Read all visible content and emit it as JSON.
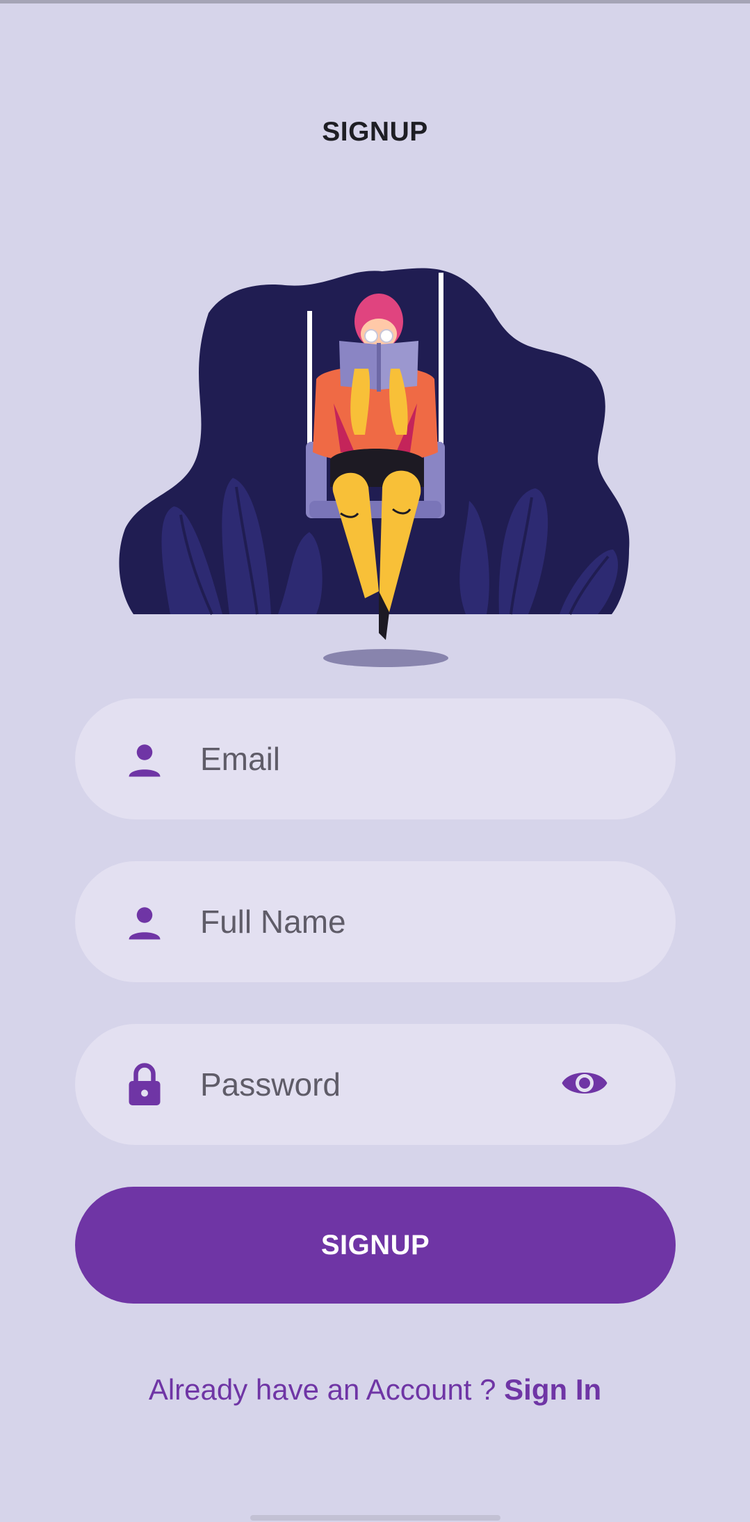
{
  "page": {
    "title": "SIGNUP"
  },
  "form": {
    "email": {
      "placeholder": "Email",
      "icon": "person-icon"
    },
    "full_name": {
      "placeholder": "Full Name",
      "icon": "person-icon"
    },
    "password": {
      "placeholder": "Password",
      "icon": "lock-icon",
      "toggle_icon": "eye-icon"
    }
  },
  "actions": {
    "signup_label": "SIGNUP"
  },
  "footer": {
    "prompt": "Already have an Account ? ",
    "link": "Sign In"
  },
  "colors": {
    "background": "#d6d4ea",
    "field": "#e3e0f1",
    "accent": "#6f35a5",
    "text": "#1e1e24"
  }
}
